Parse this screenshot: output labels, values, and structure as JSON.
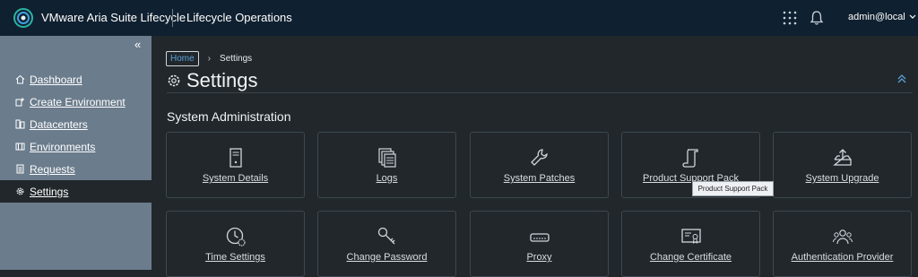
{
  "header": {
    "app_title": "VMware Aria Suite Lifecycle",
    "section_title": "Lifecycle Operations",
    "user": "admin@local",
    "icons": [
      "vmware-logo-icon",
      "apps-grid-icon",
      "bell-icon",
      "chevron-down-icon"
    ]
  },
  "sidebar": {
    "collapse_icon": "double-chevron-left-icon",
    "items": [
      {
        "label": "Dashboard",
        "icon": "home-icon"
      },
      {
        "label": "Create Environment",
        "icon": "create-env-icon"
      },
      {
        "label": "Datacenters",
        "icon": "datacenter-icon"
      },
      {
        "label": "Environments",
        "icon": "environments-icon"
      },
      {
        "label": "Requests",
        "icon": "requests-icon"
      },
      {
        "label": "Settings",
        "icon": "gear-icon",
        "active": true
      }
    ]
  },
  "breadcrumb": {
    "home": "Home",
    "current": "Settings"
  },
  "page": {
    "title": "Settings",
    "group_heading": "System Administration"
  },
  "cards": [
    {
      "label": "System Details",
      "icon": "server-icon"
    },
    {
      "label": "Logs",
      "icon": "logs-icon"
    },
    {
      "label": "System Patches",
      "icon": "wrench-icon"
    },
    {
      "label": "Product Support Pack",
      "icon": "scroll-icon"
    },
    {
      "label": "System Upgrade",
      "icon": "upload-tray-icon"
    },
    {
      "label": "Time Settings",
      "icon": "clock-gear-icon"
    },
    {
      "label": "Change Password",
      "icon": "key-icon"
    },
    {
      "label": "Proxy",
      "icon": "proxy-icon"
    },
    {
      "label": "Change Certificate",
      "icon": "certificate-icon"
    },
    {
      "label": "Authentication Provider",
      "icon": "users-icon"
    }
  ],
  "tooltip": "Product Support Pack",
  "colors": {
    "header_bg": "#0f2030",
    "sidebar_bg": "#6b7c8c",
    "content_bg": "#21272b",
    "link_blue": "#5aa0d8"
  }
}
